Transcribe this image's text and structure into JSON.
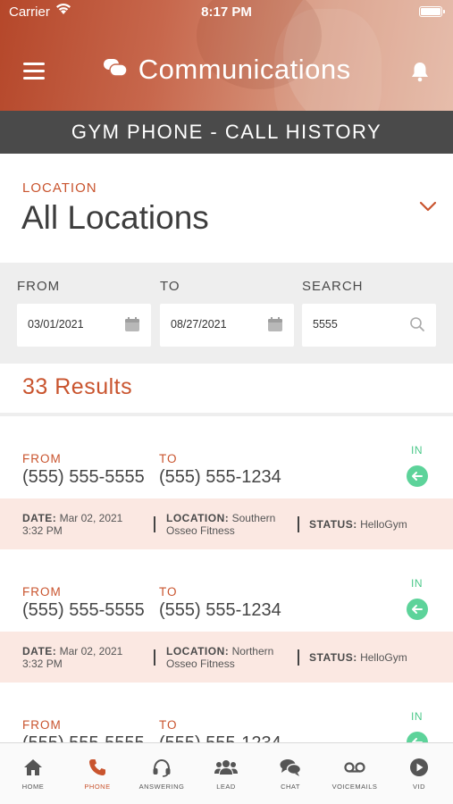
{
  "status_bar": {
    "carrier": "Carrier",
    "time": "8:17 PM"
  },
  "header": {
    "title": "Communications"
  },
  "page_heading": "GYM PHONE - CALL HISTORY",
  "location": {
    "label": "LOCATION",
    "value": "All Locations"
  },
  "filters": {
    "from": {
      "label": "FROM",
      "value": "03/01/2021"
    },
    "to": {
      "label": "TO",
      "value": "08/27/2021"
    },
    "search": {
      "label": "SEARCH",
      "value": "5555"
    }
  },
  "results_label": "33 Results",
  "calls": [
    {
      "from_label": "FROM",
      "from": "(555) 555-5555",
      "to_label": "TO",
      "to": "(555) 555-1234",
      "direction": "IN",
      "date_label": "DATE:",
      "date": "Mar 02, 2021",
      "time": "3:32 PM",
      "location_label": "LOCATION:",
      "location_line1": "Southern",
      "location_line2": "Osseo Fitness",
      "status_label": "STATUS:",
      "status": "HelloGym"
    },
    {
      "from_label": "FROM",
      "from": "(555) 555-5555",
      "to_label": "TO",
      "to": "(555) 555-1234",
      "direction": "IN",
      "date_label": "DATE:",
      "date": "Mar 02, 2021",
      "time": "3:32 PM",
      "location_label": "LOCATION:",
      "location_line1": "Northern",
      "location_line2": "Osseo Fitness",
      "status_label": "STATUS:",
      "status": "HelloGym"
    },
    {
      "from_label": "FROM",
      "from": "(555) 555-5555",
      "to_label": "TO",
      "to": "(555) 555-1234",
      "direction": "IN"
    }
  ],
  "tabs": [
    {
      "label": "HOME",
      "icon": "home-icon"
    },
    {
      "label": "PHONE",
      "icon": "phone-icon",
      "active": true
    },
    {
      "label": "ANSWERING",
      "icon": "headset-icon"
    },
    {
      "label": "LEAD",
      "icon": "users-icon"
    },
    {
      "label": "CHAT",
      "icon": "chat-icon"
    },
    {
      "label": "VOICEMAILS",
      "icon": "voicemail-icon"
    },
    {
      "label": "VID",
      "icon": "play-icon"
    }
  ],
  "colors": {
    "accent": "#c9542e",
    "in_green": "#5dd39a",
    "heading_bar": "#4a4a4a",
    "row_meta_bg": "#fbe8e2"
  }
}
